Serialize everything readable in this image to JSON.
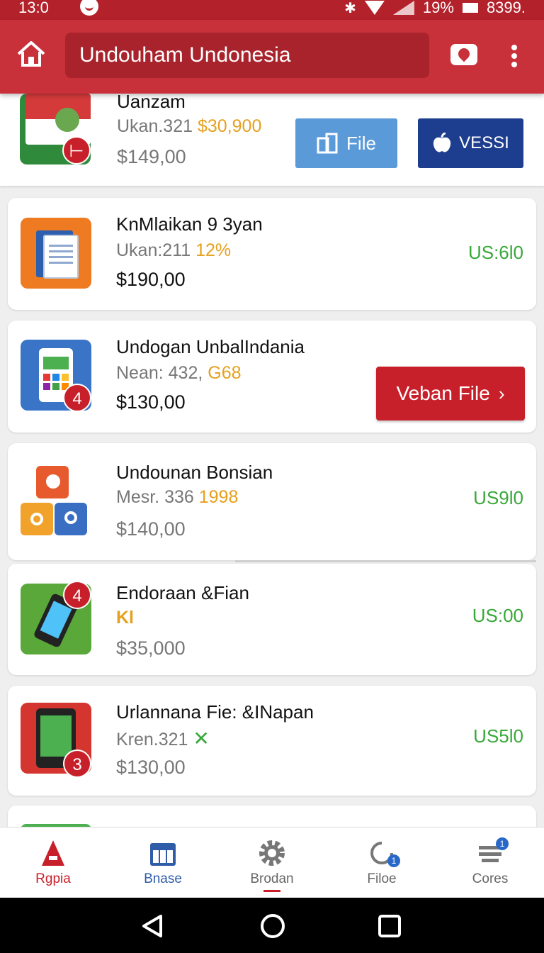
{
  "status_bar": {
    "time": "13:0",
    "battery": "19%",
    "extra": "8399."
  },
  "app_bar": {
    "search_text": "Undouham Undonesia"
  },
  "items": [
    {
      "title": "Uanzam",
      "meta": "Ukan.321",
      "meta_highlight": "$30,900",
      "price": "$149,00"
    },
    {
      "title": "KnMlaikan 9 3yan",
      "meta": "Ukan:211",
      "meta_highlight": "12%",
      "price": "$190,00",
      "usd": "US:6l0"
    },
    {
      "title": "Undogan UnbalIndania",
      "meta": "Nean: 432,",
      "meta_highlight": "G68",
      "price": "$130,00",
      "badge": "4"
    },
    {
      "title": "Undounan Bonsian",
      "meta": "Mesr. 336",
      "meta_highlight": "1998",
      "price": "$140,00",
      "usd": "US9l0"
    },
    {
      "title": "Endoraan &Fian",
      "meta_highlight": "Kl",
      "price": "$35,000",
      "usd": "US:00",
      "badge": "4"
    },
    {
      "title": "Urlannana Fie: &INapan",
      "meta": "Kren.321",
      "price": "$130,00",
      "usd": "US5l0",
      "badge": "3"
    }
  ],
  "buttons": {
    "file": "File",
    "vessi": "VESSI",
    "veban": "Veban File"
  },
  "bottom_nav": [
    {
      "label": "Rgpia",
      "icon": "store-icon",
      "state": "active"
    },
    {
      "label": "Bnase",
      "icon": "calendar-icon"
    },
    {
      "label": "Brodan",
      "icon": "gear-icon"
    },
    {
      "label": "Filoe",
      "icon": "refresh-icon",
      "badge": "1"
    },
    {
      "label": "Cores",
      "icon": "stack-icon",
      "badge": "1"
    }
  ],
  "colors": {
    "primary": "#c8303a",
    "green": "#38a83a",
    "orange": "#e6a01f",
    "blue": "#5b9ad8",
    "navy": "#1d3d8e"
  }
}
